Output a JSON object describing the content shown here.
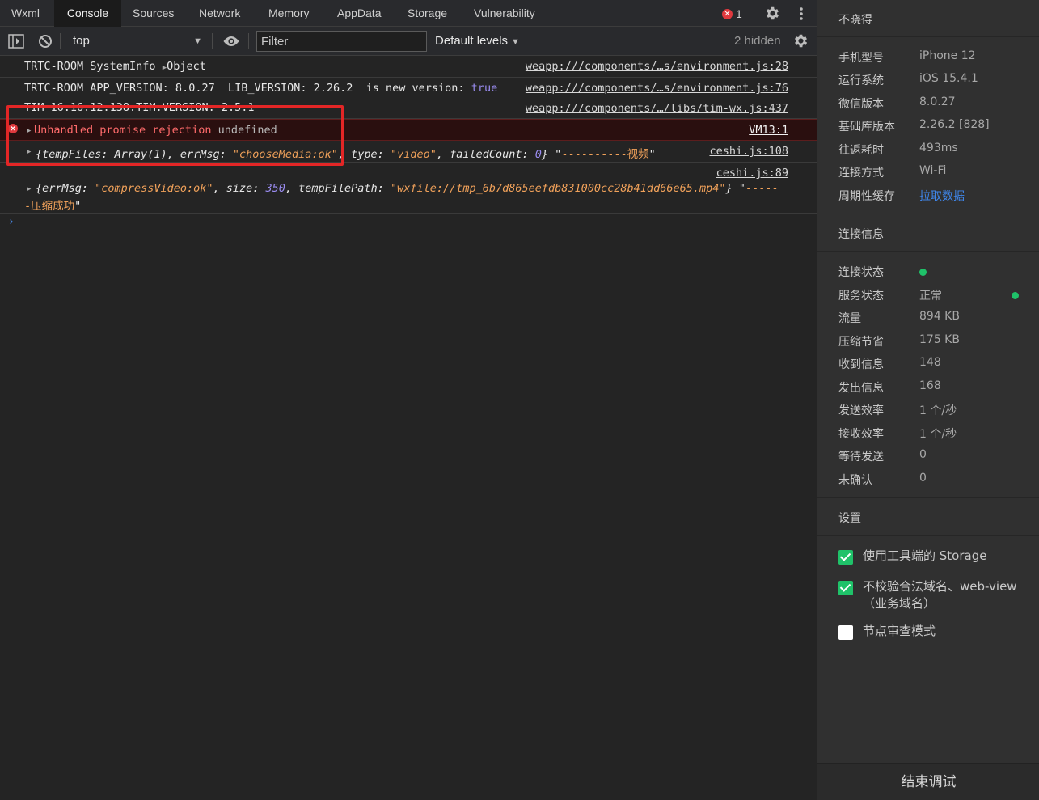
{
  "tabs": {
    "wxml": "Wxml",
    "console": "Console",
    "sources": "Sources",
    "network": "Network",
    "memory": "Memory",
    "appdata": "AppData",
    "storage": "Storage",
    "vulnerability": "Vulnerability"
  },
  "error_count": "1",
  "toolbar": {
    "context": "top",
    "filter_placeholder": "Filter",
    "levels": "Default levels",
    "hidden": "2 hidden"
  },
  "console": {
    "m1": {
      "text": "TRTC-ROOM SystemInfo ",
      "obj": "Object",
      "src": "weapp:///components/…s/environment.js:28"
    },
    "m2": {
      "text": "TRTC-ROOM APP_VERSION: 8.0.27  LIB_VERSION: 2.26.2  is new version: ",
      "bool": "true",
      "src": "weapp:///components/…s/environment.js:76"
    },
    "m3": {
      "text": "TIM 16:16:12.138:TIM.VERSION: 2.5.1",
      "src": "weapp:///components/…/libs/tim-wx.js:437"
    },
    "m4": {
      "text": "Unhandled promise rejection ",
      "undef": "undefined",
      "src": "VM13:1"
    },
    "m5": {
      "open": "{",
      "k1": "tempFiles:",
      "v1": " Array(1)",
      "k2": ", errMsg:",
      "v2": " \"chooseMedia:ok\"",
      "k3": ", type:",
      "v3": " \"video\"",
      "k4": ", failedCount:",
      "v4": " 0",
      "close": "} ",
      "tail_q1": "\"",
      "tail": "----------视频",
      "tail_q2": "\"",
      "src": "ceshi.js:108"
    },
    "m6": {
      "src": "ceshi.js:89",
      "open": "{",
      "k1": "errMsg:",
      "v1": " \"compressVideo:ok\"",
      "k2": ", size:",
      "v2": " 350",
      "k3": ", tempFilePath:",
      "v3": " \"wxfile://tmp_6b7d865eefdb831000cc28b41dd66e65.mp4\"",
      "close": "} ",
      "tail_q1": "\"",
      "tail1": "-----",
      "tail2": "-压缩成功",
      "tail_q2": "\""
    },
    "prompt": "›"
  },
  "panel": {
    "title": "不晓得",
    "device": [
      {
        "k": "手机型号",
        "v": "iPhone 12"
      },
      {
        "k": "运行系统",
        "v": "iOS 15.4.1"
      },
      {
        "k": "微信版本",
        "v": "8.0.27"
      },
      {
        "k": "基础库版本",
        "v": "2.26.2 [828]"
      },
      {
        "k": "往返耗时",
        "v": "493ms"
      },
      {
        "k": "连接方式",
        "v": "Wi-Fi"
      },
      {
        "k": "周期性缓存",
        "v": "拉取数据"
      }
    ],
    "conn_title": "连接信息",
    "conn": [
      {
        "k": "连接状态",
        "v": ""
      },
      {
        "k": "服务状态",
        "v": "正常"
      },
      {
        "k": "流量",
        "v": "894 KB"
      },
      {
        "k": "压缩节省",
        "v": "175 KB"
      },
      {
        "k": "收到信息",
        "v": "148"
      },
      {
        "k": "发出信息",
        "v": "168"
      },
      {
        "k": "发送效率",
        "v": "1 个/秒"
      },
      {
        "k": "接收效率",
        "v": "1 个/秒"
      },
      {
        "k": "等待发送",
        "v": "0"
      },
      {
        "k": "未确认",
        "v": "0"
      }
    ],
    "settings_title": "设置",
    "settings": [
      {
        "label": "使用工具端的 Storage",
        "checked": true
      },
      {
        "label": "不校验合法域名、web-view（业务域名）",
        "checked": true
      },
      {
        "label": "节点审查模式",
        "checked": false
      }
    ],
    "end_button": "结束调试"
  },
  "colors": {
    "accent_green": "#1fc269",
    "error_red": "#e0393e",
    "link_blue": "#3f86ea",
    "highlight_box": "#e32626"
  }
}
